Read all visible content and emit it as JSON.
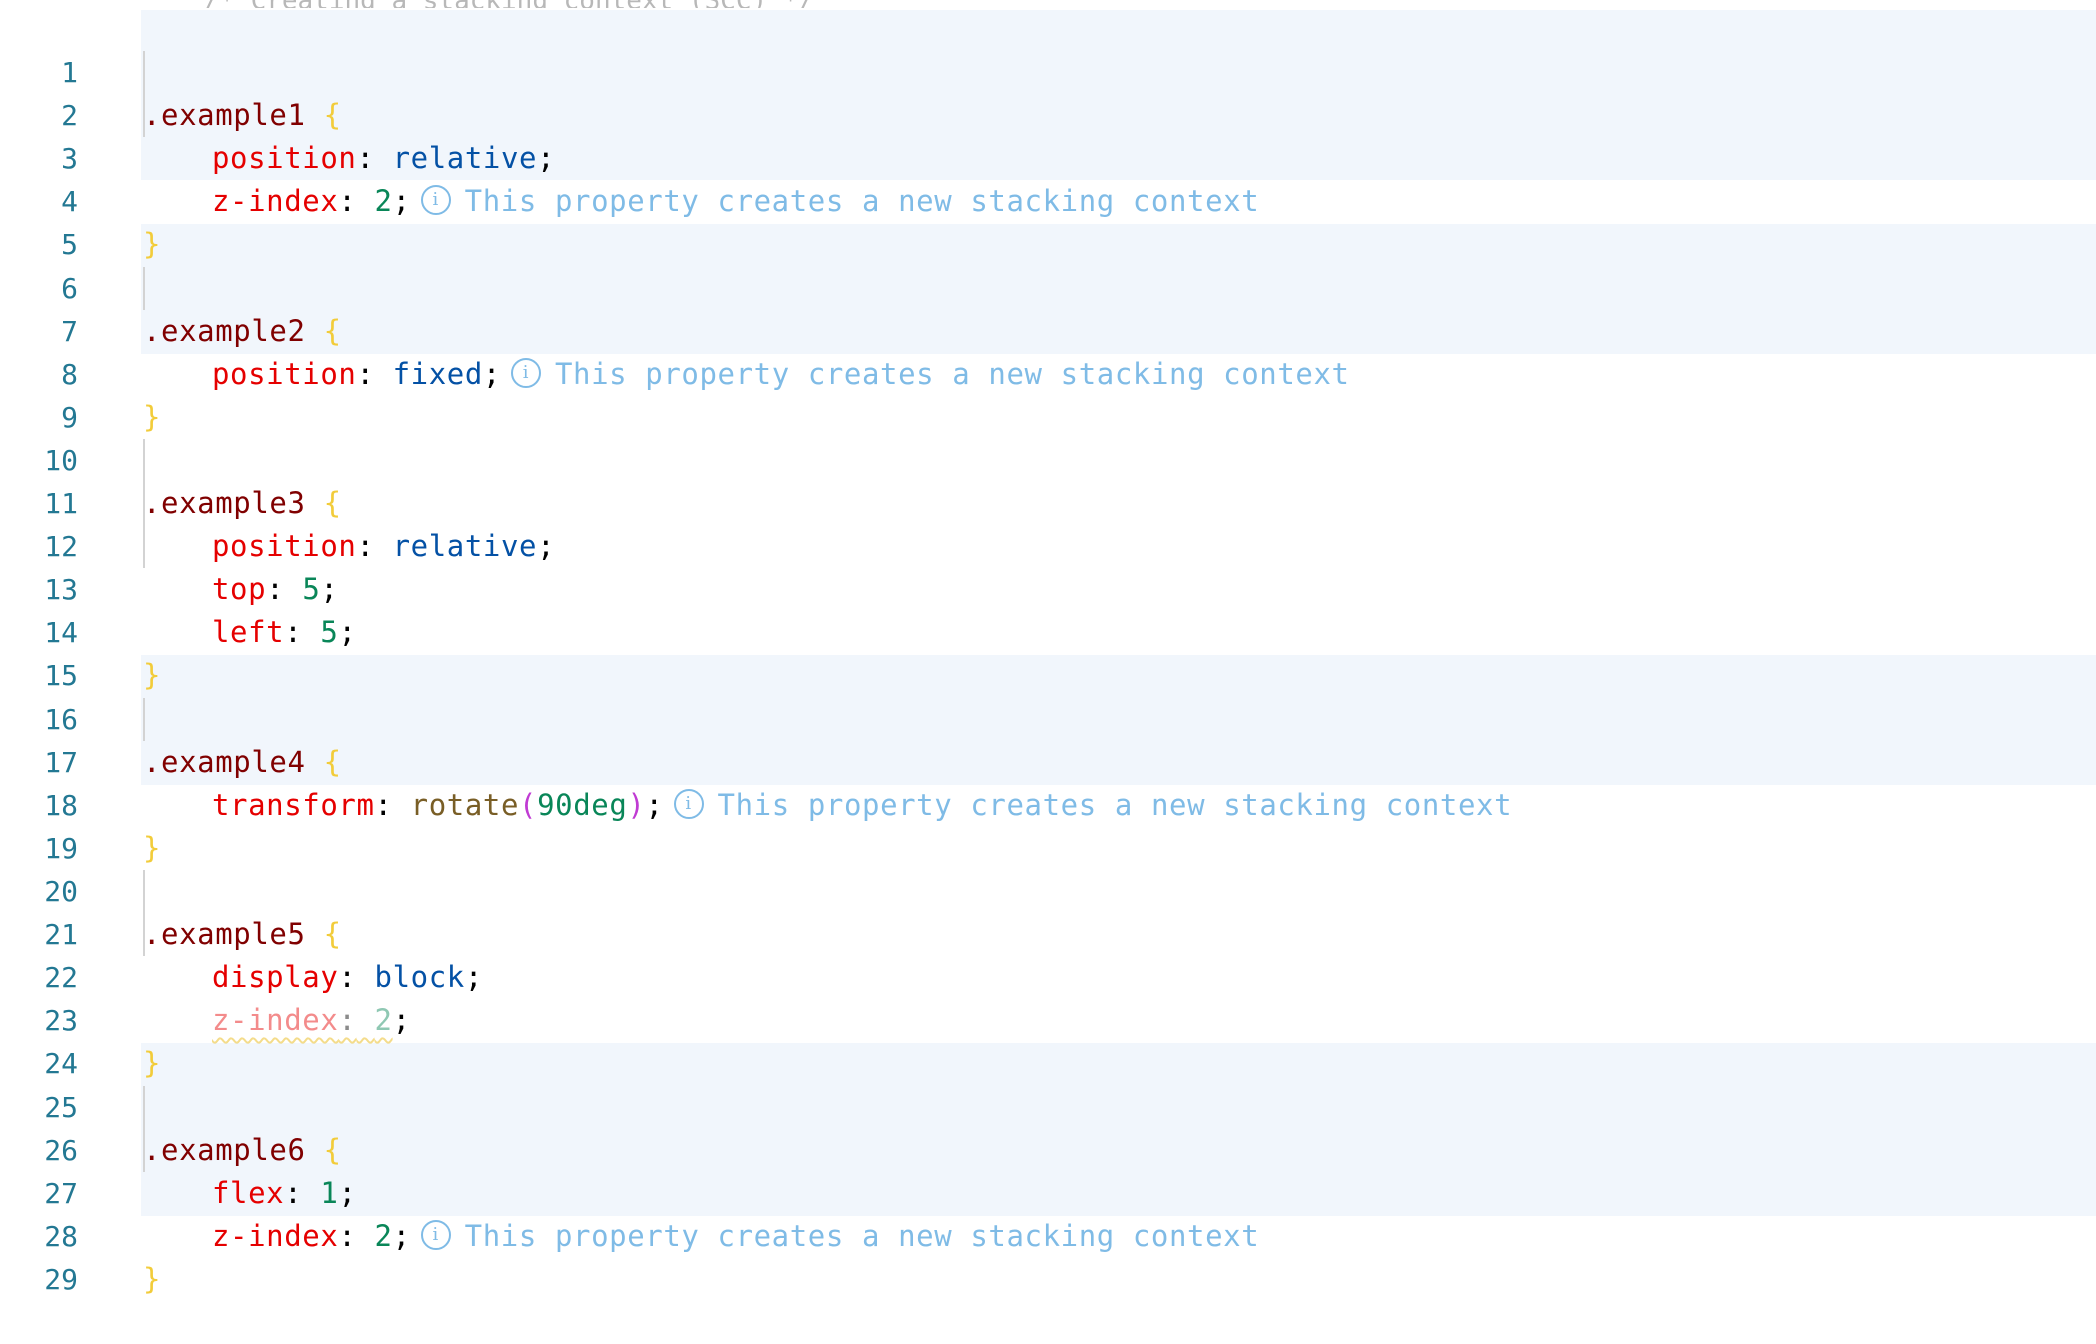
{
  "editor": {
    "cut_off_top_text": "    /* Creating a stacking context (SCC) */",
    "lines": [
      {
        "n": "1"
      },
      {
        "n": "2"
      },
      {
        "n": "3"
      },
      {
        "n": "4"
      },
      {
        "n": "5"
      },
      {
        "n": "6"
      },
      {
        "n": "7"
      },
      {
        "n": "8"
      },
      {
        "n": "9"
      },
      {
        "n": "10"
      },
      {
        "n": "11"
      },
      {
        "n": "12"
      },
      {
        "n": "13"
      },
      {
        "n": "14"
      },
      {
        "n": "15"
      },
      {
        "n": "16"
      },
      {
        "n": "17"
      },
      {
        "n": "18"
      },
      {
        "n": "19"
      },
      {
        "n": "20"
      },
      {
        "n": "21"
      },
      {
        "n": "22"
      },
      {
        "n": "23"
      },
      {
        "n": "24"
      },
      {
        "n": "25"
      },
      {
        "n": "26"
      },
      {
        "n": "27"
      },
      {
        "n": "28"
      },
      {
        "n": "29"
      }
    ],
    "tokens": {
      "sel1": ".example1",
      "sel2": ".example2",
      "sel3": ".example3",
      "sel4": ".example4",
      "sel5": ".example5",
      "sel6": ".example6",
      "open_brace": "{",
      "close_brace": "}",
      "colon": ":",
      "semicolon": ";",
      "prop_position": "position",
      "prop_zindex": "z-index",
      "prop_top": "top",
      "prop_left": "left",
      "prop_transform": "transform",
      "prop_display": "display",
      "prop_flex": "flex",
      "val_relative": "relative",
      "val_fixed": "fixed",
      "val_block": "block",
      "val_2": "2",
      "val_5": "5",
      "val_1": "1",
      "fn_rotate": "rotate",
      "paren_open": "(",
      "paren_close": ")",
      "val_90deg": "90deg",
      "info_icon_glyph": "i",
      "hint_text": "This property creates a new stacking context"
    },
    "icons": {
      "inlay_hint": "info-circle-icon"
    },
    "colors": {
      "selector": "#800000",
      "property": "#e50000",
      "keyword_value": "#0451a5",
      "number": "#098658",
      "function": "#795e26",
      "paren": "#c03bd3",
      "brace": "#f2cc3a",
      "line_number": "#237893",
      "inlay_hint": "#7fbbe6",
      "block_highlight": "#f1f6fc",
      "warning_squiggle": "#e8b300"
    }
  }
}
